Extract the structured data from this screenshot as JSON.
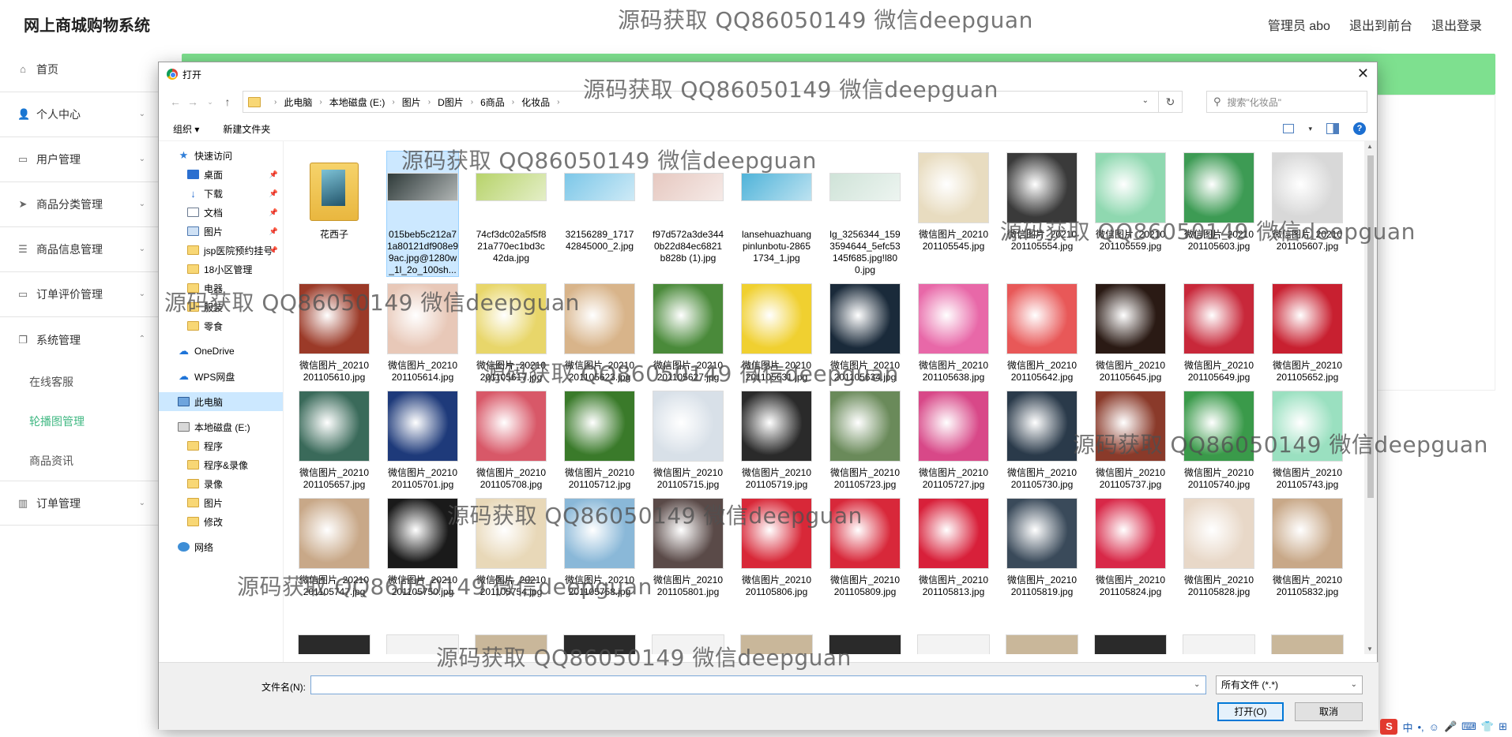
{
  "app": {
    "title": "网上商城购物系统",
    "user": "管理员 abo",
    "front_link": "退出到前台",
    "logout_link": "退出登录"
  },
  "sidebar": {
    "items": [
      {
        "label": "首页",
        "icon": "home-icon"
      },
      {
        "label": "个人中心",
        "icon": "user-icon"
      },
      {
        "label": "用户管理",
        "icon": "monitor-icon"
      },
      {
        "label": "商品分类管理",
        "icon": "send-icon"
      },
      {
        "label": "商品信息管理",
        "icon": "list-icon"
      },
      {
        "label": "订单评价管理",
        "icon": "monitor-icon"
      },
      {
        "label": "系统管理",
        "icon": "copy-icon"
      }
    ],
    "sub_items": [
      "在线客服",
      "轮播图管理",
      "商品资讯"
    ],
    "last_item": {
      "label": "订单管理",
      "icon": "chart-icon"
    },
    "active_color": "#41b883"
  },
  "dialog": {
    "title": "打开",
    "breadcrumbs": [
      "此电脑",
      "本地磁盘 (E:)",
      "图片",
      "D图片",
      "6商品",
      "化妆品"
    ],
    "search_placeholder": "搜索\"化妆品\"",
    "toolbar": {
      "organize": "组织 ▾",
      "new_folder": "新建文件夹"
    },
    "nav_tree": [
      {
        "label": "快速访问",
        "icon": "star-icon",
        "indent": 0,
        "pin": false
      },
      {
        "label": "桌面",
        "icon": "desktop-icon",
        "indent": 1,
        "pin": true
      },
      {
        "label": "下载",
        "icon": "download-icon",
        "indent": 1,
        "pin": true
      },
      {
        "label": "文档",
        "icon": "document-icon",
        "indent": 1,
        "pin": true
      },
      {
        "label": "图片",
        "icon": "pictures-icon",
        "indent": 1,
        "pin": true
      },
      {
        "label": "jsp医院预约挂号",
        "icon": "folder-icon",
        "indent": 1,
        "pin": true
      },
      {
        "label": "18小区管理",
        "icon": "folder-icon",
        "indent": 1,
        "pin": false
      },
      {
        "label": "电器",
        "icon": "folder-icon",
        "indent": 1,
        "pin": false
      },
      {
        "label": "服装",
        "icon": "folder-icon",
        "indent": 1,
        "pin": false
      },
      {
        "label": "零食",
        "icon": "folder-icon",
        "indent": 1,
        "pin": false
      },
      {
        "label": "",
        "icon": "",
        "indent": 0,
        "pin": false
      },
      {
        "label": "OneDrive",
        "icon": "cloud-icon",
        "indent": 0,
        "pin": false
      },
      {
        "label": "",
        "icon": "",
        "indent": 0,
        "pin": false
      },
      {
        "label": "WPS网盘",
        "icon": "cloud-icon",
        "indent": 0,
        "pin": false
      },
      {
        "label": "",
        "icon": "",
        "indent": 0,
        "pin": false
      },
      {
        "label": "此电脑",
        "icon": "computer-icon",
        "indent": 0,
        "pin": false,
        "selected": true
      },
      {
        "label": "",
        "icon": "",
        "indent": 0,
        "pin": false
      },
      {
        "label": "本地磁盘 (E:)",
        "icon": "drive-icon",
        "indent": 0,
        "pin": false
      },
      {
        "label": "程序",
        "icon": "folder-icon",
        "indent": 1,
        "pin": false
      },
      {
        "label": "程序&录像",
        "icon": "folder-icon",
        "indent": 1,
        "pin": false
      },
      {
        "label": "录像",
        "icon": "folder-icon",
        "indent": 1,
        "pin": false
      },
      {
        "label": "图片",
        "icon": "folder-icon",
        "indent": 1,
        "pin": false
      },
      {
        "label": "修改",
        "icon": "folder-icon",
        "indent": 1,
        "pin": false
      },
      {
        "label": "",
        "icon": "",
        "indent": 0,
        "pin": false
      },
      {
        "label": "网络",
        "icon": "network-icon",
        "indent": 0,
        "pin": false
      }
    ],
    "files": [
      {
        "name": "花西子",
        "kind": "folder",
        "color": "#f2c94c"
      },
      {
        "name": "015beb5c212a71a80121df908e99ac.jpg@1280w_1l_2o_100sh...",
        "kind": "band",
        "color": "#2f3b3a",
        "selected": true
      },
      {
        "name": "74cf3dc02a5f5f821a770ec1bd3c42da.jpg",
        "kind": "band",
        "color": "#b7d36a"
      },
      {
        "name": "32156289_171742845000_2.jpg",
        "kind": "band",
        "color": "#7cc7e8"
      },
      {
        "name": "f97d572a3de3440b22d84ec6821b828b (1).jpg",
        "kind": "band",
        "color": "#e6c8c0"
      },
      {
        "name": "lansehuazhuangpinlunbotu-28651734_1.jpg",
        "kind": "band",
        "color": "#4fb3d9"
      },
      {
        "name": "lg_3256344_1593594644_5efc53145f685.jpg!l800.jpg",
        "kind": "band",
        "color": "#cfe3d8"
      },
      {
        "name": "微信图片_20210201105545.jpg",
        "kind": "photo",
        "color": "#e8dcc0"
      },
      {
        "name": "微信图片_20210201105554.jpg",
        "kind": "photo",
        "color": "#3a3a3a"
      },
      {
        "name": "微信图片_20210201105559.jpg",
        "kind": "photo",
        "color": "#8fd8b0"
      },
      {
        "name": "微信图片_20210201105603.jpg",
        "kind": "photo",
        "color": "#3d9b54"
      },
      {
        "name": "微信图片_20210201105607.jpg",
        "kind": "photo",
        "color": "#d8d8d8"
      },
      {
        "name": "微信图片_20210201105610.jpg",
        "kind": "photo",
        "color": "#9b3a28"
      },
      {
        "name": "微信图片_20210201105614.jpg",
        "kind": "photo",
        "color": "#e8c8b8"
      },
      {
        "name": "微信图片_20210201105617.jpg",
        "kind": "photo",
        "color": "#e8d66a"
      },
      {
        "name": "微信图片_20210201105623.jpg",
        "kind": "photo",
        "color": "#d8b48a"
      },
      {
        "name": "微信图片_20210201105627.jpg",
        "kind": "photo",
        "color": "#4a8a3a"
      },
      {
        "name": "微信图片_20210201105631.jpg",
        "kind": "photo",
        "color": "#f0d030"
      },
      {
        "name": "微信图片_20210201105634.jpg",
        "kind": "photo",
        "color": "#1a2a3a"
      },
      {
        "name": "微信图片_20210201105638.jpg",
        "kind": "photo",
        "color": "#e868a8"
      },
      {
        "name": "微信图片_20210201105642.jpg",
        "kind": "photo",
        "color": "#e85858"
      },
      {
        "name": "微信图片_20210201105645.jpg",
        "kind": "photo",
        "color": "#2a1a14"
      },
      {
        "name": "微信图片_20210201105649.jpg",
        "kind": "photo",
        "color": "#c8283a"
      },
      {
        "name": "微信图片_20210201105652.jpg",
        "kind": "photo",
        "color": "#c82030"
      },
      {
        "name": "微信图片_20210201105657.jpg",
        "kind": "photo",
        "color": "#3a6a5a"
      },
      {
        "name": "微信图片_20210201105701.jpg",
        "kind": "photo",
        "color": "#1e3a7a"
      },
      {
        "name": "微信图片_20210201105708.jpg",
        "kind": "photo",
        "color": "#d85868"
      },
      {
        "name": "微信图片_20210201105712.jpg",
        "kind": "photo",
        "color": "#3a7a2a"
      },
      {
        "name": "微信图片_20210201105715.jpg",
        "kind": "photo",
        "color": "#d8e0e8"
      },
      {
        "name": "微信图片_20210201105719.jpg",
        "kind": "photo",
        "color": "#2a2a2a"
      },
      {
        "name": "微信图片_20210201105723.jpg",
        "kind": "photo",
        "color": "#6a8a5a"
      },
      {
        "name": "微信图片_20210201105727.jpg",
        "kind": "photo",
        "color": "#d84888"
      },
      {
        "name": "微信图片_20210201105730.jpg",
        "kind": "photo",
        "color": "#2a3a4a"
      },
      {
        "name": "微信图片_20210201105737.jpg",
        "kind": "photo",
        "color": "#8a3a2a"
      },
      {
        "name": "微信图片_20210201105740.jpg",
        "kind": "photo",
        "color": "#3a9a4a"
      },
      {
        "name": "微信图片_20210201105743.jpg",
        "kind": "photo",
        "color": "#9ae0c0"
      },
      {
        "name": "微信图片_20210201105747.jpg",
        "kind": "photo",
        "color": "#c8a888"
      },
      {
        "name": "微信图片_20210201105750.jpg",
        "kind": "photo",
        "color": "#1a1a1a"
      },
      {
        "name": "微信图片_20210201105754.jpg",
        "kind": "photo",
        "color": "#e8d8b8"
      },
      {
        "name": "微信图片_20210201105758.jpg",
        "kind": "photo",
        "color": "#8ab8d8"
      },
      {
        "name": "微信图片_20210201105801.jpg",
        "kind": "photo",
        "color": "#5a4a48"
      },
      {
        "name": "微信图片_20210201105806.jpg",
        "kind": "photo",
        "color": "#d82838"
      },
      {
        "name": "微信图片_20210201105809.jpg",
        "kind": "photo",
        "color": "#d8283a"
      },
      {
        "name": "微信图片_20210201105813.jpg",
        "kind": "photo",
        "color": "#d8203a"
      },
      {
        "name": "微信图片_20210201105819.jpg",
        "kind": "photo",
        "color": "#3a4a5a"
      },
      {
        "name": "微信图片_20210201105824.jpg",
        "kind": "photo",
        "color": "#d82848"
      },
      {
        "name": "微信图片_20210201105828.jpg",
        "kind": "photo",
        "color": "#e8d8c8"
      },
      {
        "name": "微信图片_20210201105832.jpg",
        "kind": "photo",
        "color": "#c8a888"
      }
    ],
    "filename_label": "文件名(N):",
    "filename_value": "",
    "filetype": "所有文件 (*.*)",
    "open_button": "打开(O)",
    "cancel_button": "取消"
  },
  "watermark": "源码获取 QQ86050149 微信deepguan",
  "tray": {
    "ime": "中",
    "punct": "•,"
  }
}
